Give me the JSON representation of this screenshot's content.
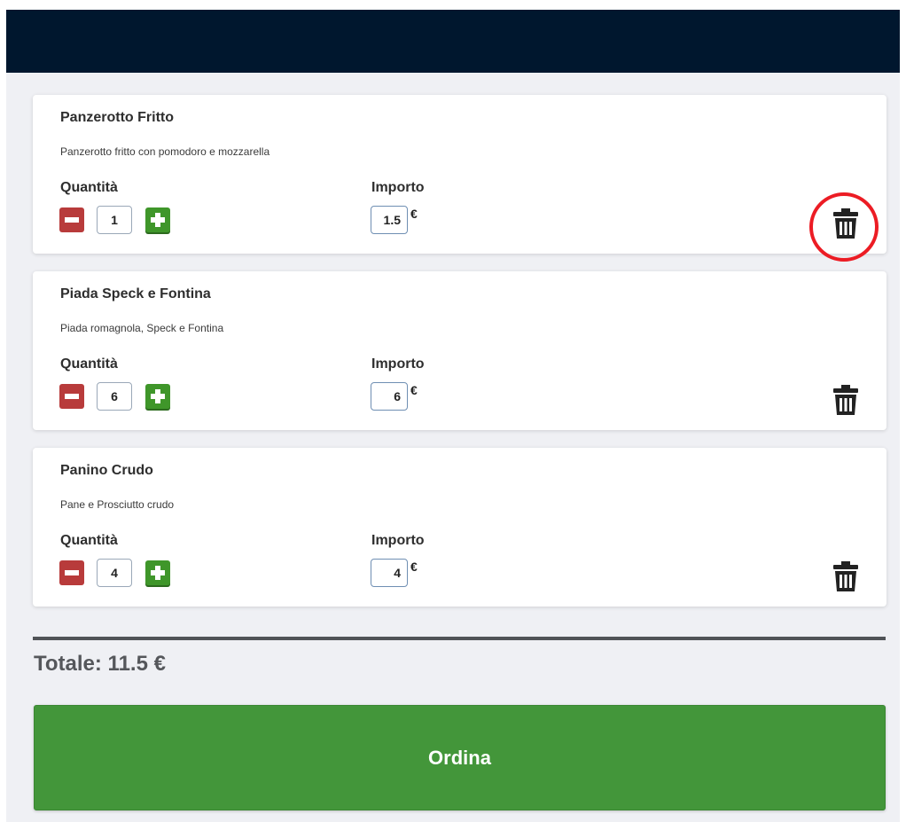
{
  "cart": {
    "items": [
      {
        "name": "Panzerotto Fritto",
        "description": "Panzerotto fritto con pomodoro e mozzarella",
        "quantity_label": "Quantità",
        "quantity": "1",
        "amount_label": "Importo",
        "amount": "1.5",
        "currency": "€"
      },
      {
        "name": "Piada Speck e Fontina",
        "description": "Piada romagnola, Speck e Fontina",
        "quantity_label": "Quantità",
        "quantity": "6",
        "amount_label": "Importo",
        "amount": "6",
        "currency": "€"
      },
      {
        "name": "Panino Crudo",
        "description": "Pane e Prosciutto crudo",
        "quantity_label": "Quantità",
        "quantity": "4",
        "amount_label": "Importo",
        "amount": "4",
        "currency": "€"
      }
    ]
  },
  "summary": {
    "total_label": "Totale: 11.5 €",
    "order_button": "Ordina"
  },
  "icons": {
    "decrement": "minus-square-icon",
    "increment": "plus-square-icon",
    "delete": "trash-icon"
  },
  "colors": {
    "header": "#00172e",
    "background": "#eff0f4",
    "minus": "#b83b3b",
    "plus": "#3f962a",
    "order_button": "#43963a",
    "annotation_ring": "#ec1c24"
  }
}
